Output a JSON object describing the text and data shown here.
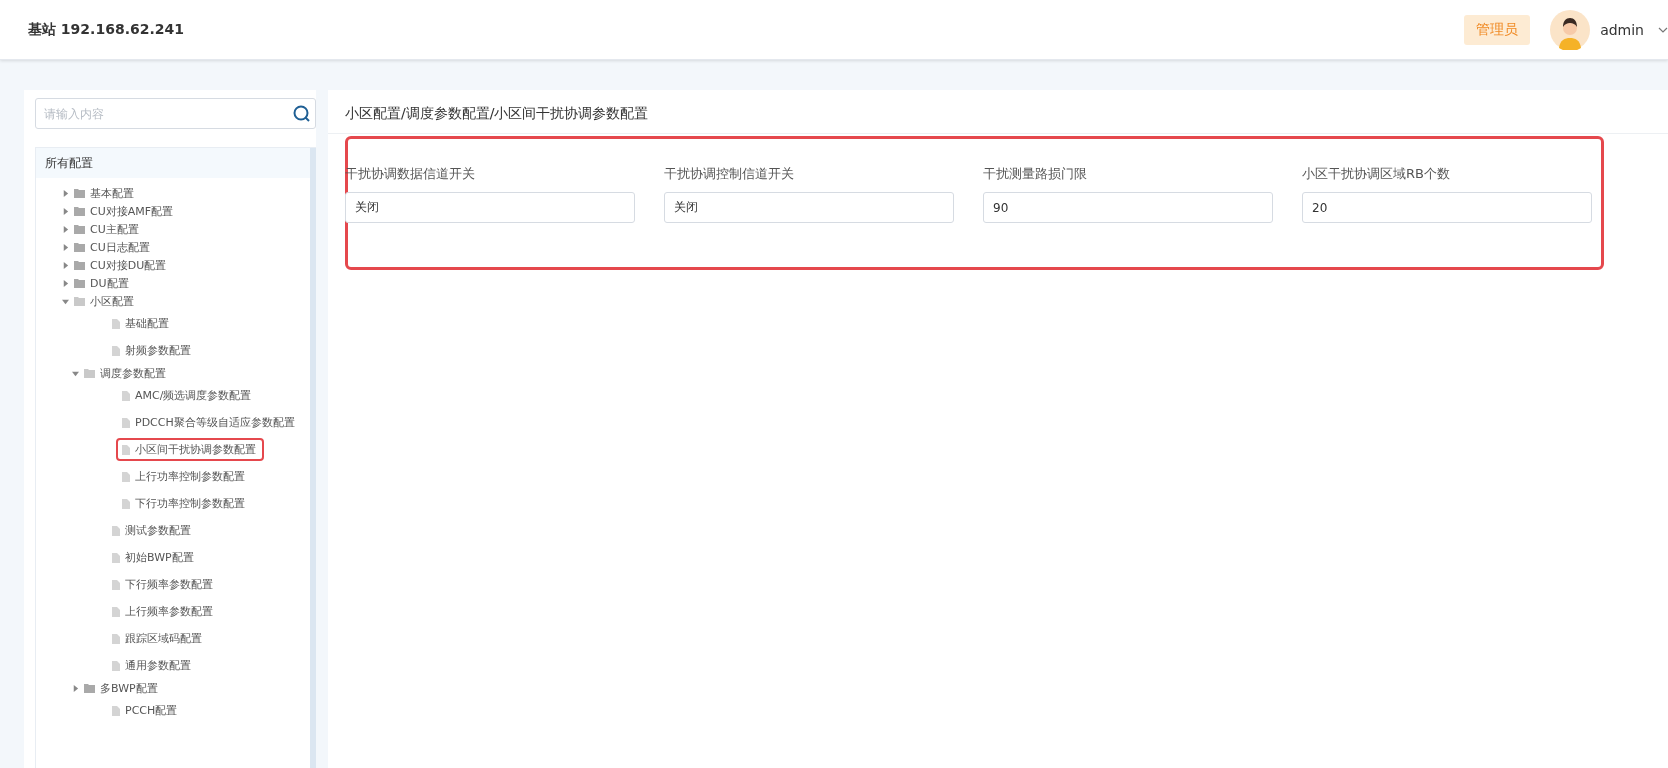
{
  "header": {
    "title": "基站 192.168.62.241",
    "role_badge": "管理员",
    "user": "admin"
  },
  "sidebar": {
    "search": {
      "placeholder": "请输入内容"
    },
    "tree_title": "所有配置",
    "tree": [
      {
        "label": "基本配置",
        "kind": "folder",
        "expanded": false,
        "highlighted": false
      },
      {
        "label": "CU对接AMF配置",
        "kind": "folder",
        "expanded": false,
        "highlighted": false
      },
      {
        "label": "CU主配置",
        "kind": "folder",
        "expanded": false,
        "highlighted": false
      },
      {
        "label": "CU日志配置",
        "kind": "folder",
        "expanded": false,
        "highlighted": false
      },
      {
        "label": "CU对接DU配置",
        "kind": "folder",
        "expanded": false,
        "highlighted": false
      },
      {
        "label": "DU配置",
        "kind": "folder",
        "expanded": false,
        "highlighted": false
      },
      {
        "label": "小区配置",
        "kind": "folder",
        "expanded": true,
        "highlighted": false,
        "children": [
          {
            "label": "基础配置",
            "kind": "file",
            "highlighted": false
          },
          {
            "label": "射频参数配置",
            "kind": "file",
            "highlighted": false
          },
          {
            "label": "调度参数配置",
            "kind": "folder",
            "expanded": true,
            "highlighted": false,
            "children": [
              {
                "label": "AMC/频选调度参数配置",
                "kind": "file",
                "highlighted": false
              },
              {
                "label": "PDCCH聚合等级自适应参数配置",
                "kind": "file",
                "highlighted": false
              },
              {
                "label": "小区间干扰协调参数配置",
                "kind": "file",
                "highlighted": true
              },
              {
                "label": "上行功率控制参数配置",
                "kind": "file",
                "highlighted": false
              },
              {
                "label": "下行功率控制参数配置",
                "kind": "file",
                "highlighted": false
              }
            ]
          },
          {
            "label": "测试参数配置",
            "kind": "file",
            "highlighted": false
          },
          {
            "label": "初始BWP配置",
            "kind": "file",
            "highlighted": false
          },
          {
            "label": "下行频率参数配置",
            "kind": "file",
            "highlighted": false
          },
          {
            "label": "上行频率参数配置",
            "kind": "file",
            "highlighted": false
          },
          {
            "label": "跟踪区域码配置",
            "kind": "file",
            "highlighted": false
          },
          {
            "label": "通用参数配置",
            "kind": "file",
            "highlighted": false
          },
          {
            "label": "多BWP配置",
            "kind": "folder",
            "expanded": false,
            "highlighted": false
          },
          {
            "label": "PCCH配置",
            "kind": "file",
            "highlighted": false
          }
        ]
      }
    ]
  },
  "content": {
    "breadcrumb": "小区配置/调度参数配置/小区间干扰协调参数配置",
    "highlighted": true,
    "fields": [
      {
        "label": "干扰协调数据信道开关",
        "value": "关闭"
      },
      {
        "label": "干扰协调控制信道开关",
        "value": "关闭"
      },
      {
        "label": "干扰测量路损门限",
        "value": "90"
      },
      {
        "label": "小区干扰协调区域RB个数",
        "value": "20"
      }
    ]
  }
}
